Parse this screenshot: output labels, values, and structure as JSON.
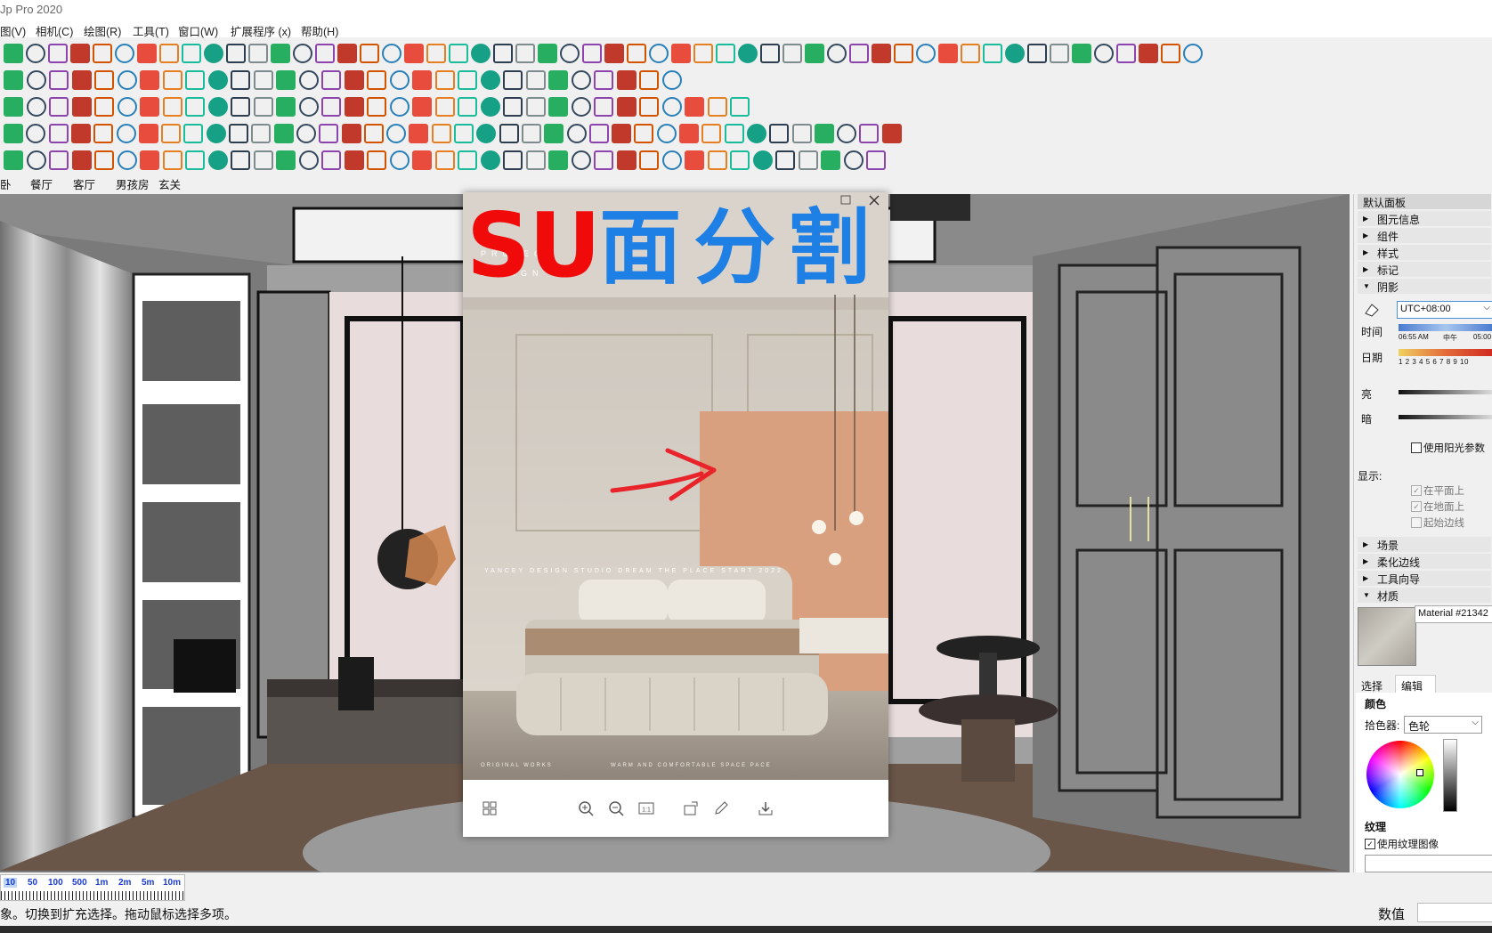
{
  "app": {
    "title": "Jp Pro 2020"
  },
  "menu": [
    "图(V)",
    "相机(C)",
    "绘图(R)",
    "工具(T)",
    "窗口(W)",
    "扩展程序 (x)",
    "帮助(H)"
  ],
  "scene_tabs": [
    "卧",
    "餐厅",
    "客厅",
    "男孩房",
    "玄关"
  ],
  "viewer": {
    "title_su": "SU",
    "title_cn": "面分割",
    "poster_lines": [
      "PROJECT",
      "DESIGN"
    ],
    "poster_caption": "YANCEY DESIGN STUDIO DREAM THE PLACE START 2022",
    "poster_bottom_left": "ORIGINAL WORKS",
    "poster_bottom_right": "WARM AND COMFORTABLE SPACE PACE"
  },
  "tray": {
    "header": "默认面板",
    "sections": [
      "图元信息",
      "组件",
      "样式",
      "标记",
      "阴影"
    ],
    "shadow": {
      "timezone": "UTC+08:00",
      "time_label": "时间",
      "time_start": "06:55 AM",
      "time_mid": "中午",
      "time_end": "05:00",
      "date_label": "日期",
      "date_ticks": "1 2 3 4 5 6 7 8 9 10",
      "light_label": "亮",
      "dark_label": "暗",
      "use_sun": "使用阳光参数",
      "display_label": "显示:",
      "on_faces": "在平面上",
      "on_ground": "在地面上",
      "from_edges": "起始边线"
    },
    "sections2": [
      "场景",
      "柔化边线",
      "工具向导",
      "材质"
    ],
    "material": {
      "name": "Material #21342",
      "tab_select": "选择",
      "tab_edit": "编辑",
      "color_label": "颜色",
      "picker_label": "拾色器:",
      "picker_value": "色轮",
      "texture_label": "纹理",
      "use_texture": "使用纹理图像"
    }
  },
  "status": {
    "ruler": [
      "10",
      "50",
      "100",
      "500",
      "1m",
      "2m",
      "5m",
      "10m"
    ],
    "hint": "象。切换到扩充选择。拖动鼠标选择多项。",
    "value_label": "数值"
  },
  "colors": {
    "su_red": "#f00a0a",
    "cn_blue": "#1e7fe4"
  }
}
